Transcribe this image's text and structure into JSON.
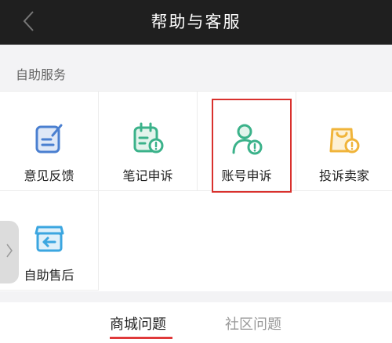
{
  "header": {
    "title": "帮助与客服",
    "back_icon": "chevron-left-icon"
  },
  "self_service": {
    "section_label": "自助服务",
    "items": [
      {
        "label": "意见反馈",
        "icon": "feedback-icon",
        "color": "#4a7fd0"
      },
      {
        "label": "笔记申诉",
        "icon": "note-appeal-icon",
        "color": "#3bb28a"
      },
      {
        "label": "账号申诉",
        "icon": "account-appeal-icon",
        "color": "#3bb28a"
      },
      {
        "label": "投诉卖家",
        "icon": "complain-seller-icon",
        "color": "#f0b43a"
      },
      {
        "label": "自助售后",
        "icon": "after-sales-icon",
        "color": "#3ba6e0"
      }
    ]
  },
  "tabs": {
    "items": [
      {
        "label": "商城问题",
        "active": true
      },
      {
        "label": "社区问题",
        "active": false
      }
    ],
    "accent": "#e0393a"
  },
  "colors": {
    "topbar": "#1f1f1f",
    "highlight_box": "#d9312d"
  }
}
